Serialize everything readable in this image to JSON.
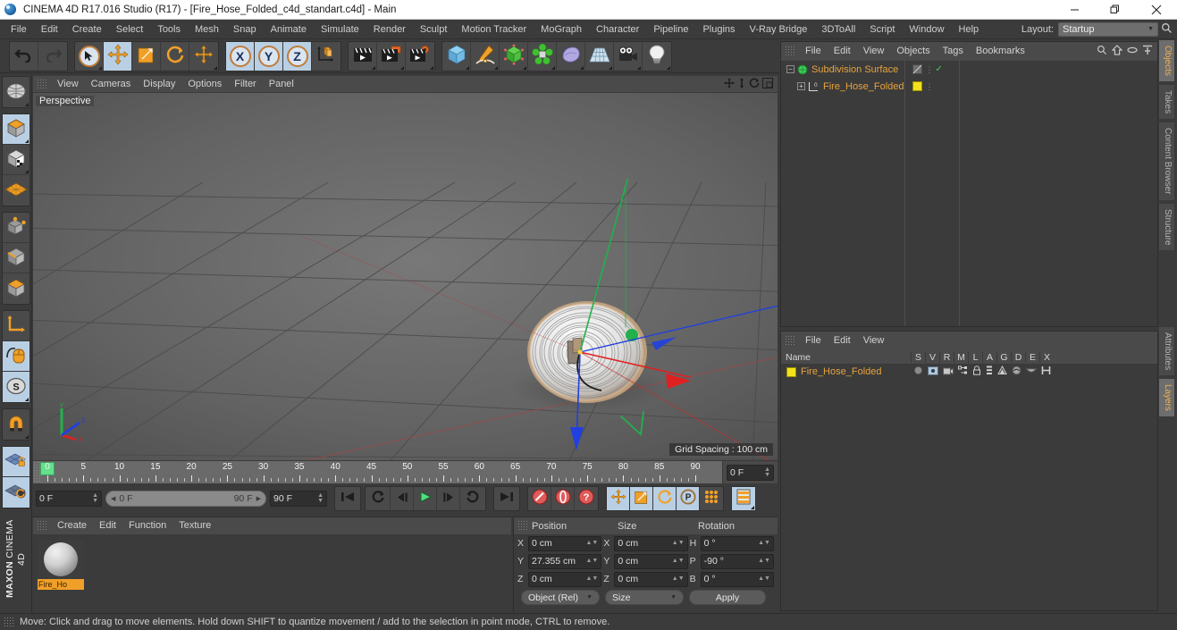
{
  "window": {
    "title": "CINEMA 4D R17.016 Studio (R17) - [Fire_Hose_Folded_c4d_standart.c4d] - Main",
    "app_icon": "c4d-logo-icon",
    "minimize": "minimize-icon",
    "maximize": "restore-icon",
    "close": "close-icon"
  },
  "menubar": {
    "items": [
      "File",
      "Edit",
      "Create",
      "Select",
      "Tools",
      "Mesh",
      "Snap",
      "Animate",
      "Simulate",
      "Render",
      "Sculpt",
      "Motion Tracker",
      "MoGraph",
      "Character",
      "Pipeline",
      "Plugins",
      "V-Ray Bridge",
      "3DToAll",
      "Script",
      "Window",
      "Help"
    ],
    "layout_label": "Layout:",
    "layout_value": "Startup",
    "search_icon": "search-icon"
  },
  "toolbar": {
    "groups": [
      {
        "name": "history",
        "buttons": [
          {
            "name": "undo-button",
            "icon": "undo-arrow-icon",
            "active": false,
            "dim": false
          },
          {
            "name": "redo-button",
            "icon": "redo-arrow-icon",
            "active": false,
            "dim": true
          }
        ]
      },
      {
        "name": "transform",
        "buttons": [
          {
            "name": "live-selection-button",
            "icon": "cursor-circle-icon",
            "active": false,
            "dim": false
          },
          {
            "name": "move-tool-button",
            "icon": "move-cross-icon",
            "active": true,
            "dim": false
          },
          {
            "name": "scale-tool-button",
            "icon": "scale-square-icon",
            "active": false,
            "dim": false
          },
          {
            "name": "rotate-tool-button",
            "icon": "rotate-circle-icon",
            "active": false,
            "dim": false
          },
          {
            "name": "free-move-button",
            "icon": "move-cross-icon",
            "active": false,
            "dim": false
          }
        ]
      },
      {
        "name": "axis-locks",
        "buttons": [
          {
            "name": "x-axis-lock-button",
            "icon": "x-axis-icon",
            "label": "X",
            "active": true,
            "dim": false
          },
          {
            "name": "y-axis-lock-button",
            "icon": "y-axis-icon",
            "label": "Y",
            "active": true,
            "dim": false
          },
          {
            "name": "z-axis-lock-button",
            "icon": "z-axis-icon",
            "label": "Z",
            "active": true,
            "dim": false
          },
          {
            "name": "world-object-coordinates-button",
            "icon": "world-axis-cube-icon",
            "active": false,
            "dim": false
          }
        ]
      },
      {
        "name": "render",
        "buttons": [
          {
            "name": "render-view-button",
            "icon": "clapperboard-icon",
            "active": false,
            "dim": false
          },
          {
            "name": "render-to-picture-viewer-button",
            "icon": "clapperboard-window-icon",
            "active": false,
            "dim": false
          },
          {
            "name": "render-settings-button",
            "icon": "clapperboard-gear-icon",
            "active": false,
            "dim": false
          }
        ]
      },
      {
        "name": "objects",
        "buttons": [
          {
            "name": "add-cube-button",
            "icon": "blue-cube-icon",
            "active": false,
            "dim": false
          },
          {
            "name": "add-spline-button",
            "icon": "pen-spline-icon",
            "active": false,
            "dim": false
          },
          {
            "name": "add-nurbs-button",
            "icon": "green-cube-nurbs-icon",
            "active": false,
            "dim": false
          },
          {
            "name": "add-array-button",
            "icon": "green-cluster-icon",
            "active": false,
            "dim": false
          },
          {
            "name": "add-deformer-button",
            "icon": "purple-blob-deformer-icon",
            "active": false,
            "dim": false
          },
          {
            "name": "add-environment-button",
            "icon": "floor-grid-icon",
            "active": false,
            "dim": false
          },
          {
            "name": "add-camera-button",
            "icon": "camera-icon",
            "active": false,
            "dim": false
          },
          {
            "name": "add-light-button",
            "icon": "lightbulb-icon",
            "active": false,
            "dim": false
          }
        ]
      }
    ]
  },
  "left_toolbar": {
    "groups": [
      {
        "name": "viewport-mode",
        "buttons": [
          {
            "name": "make-editable-button",
            "icon": "wire-globe-icon",
            "active": false
          }
        ]
      },
      {
        "name": "mode-group-1",
        "buttons": [
          {
            "name": "model-mode-button",
            "icon": "model-cube-icon",
            "active": true
          },
          {
            "name": "texture-mode-button",
            "icon": "texture-checker-cube-icon",
            "active": false
          },
          {
            "name": "workplane-mode-button",
            "icon": "orange-grid-plane-icon",
            "active": false
          }
        ]
      },
      {
        "name": "component-group",
        "buttons": [
          {
            "name": "points-mode-button",
            "icon": "point-cube-icon",
            "active": false
          },
          {
            "name": "edges-mode-button",
            "icon": "edge-cube-icon",
            "active": false
          },
          {
            "name": "polygons-mode-button",
            "icon": "polygon-cube-icon",
            "active": false
          }
        ]
      },
      {
        "name": "axis-group",
        "buttons": [
          {
            "name": "enable-axis-modification-button",
            "icon": "axis-l-icon",
            "active": false
          },
          {
            "name": "viewport-solo-button",
            "icon": "mouse-icon",
            "active": true
          },
          {
            "name": "soft-selection-button",
            "icon": "s-circle-icon",
            "active": true
          }
        ]
      },
      {
        "name": "snap-group",
        "buttons": [
          {
            "name": "enable-snap-button",
            "icon": "magnet-icon",
            "active": false
          }
        ]
      },
      {
        "name": "workplane-group",
        "buttons": [
          {
            "name": "lock-workplane-button",
            "icon": "grid-lock-icon",
            "active": true
          },
          {
            "name": "planar-workplane-button",
            "icon": "grid-rotate-icon",
            "active": true
          }
        ]
      }
    ],
    "brand_line1": "MAXON",
    "brand_line2": "CINEMA 4D"
  },
  "viewport": {
    "menu_items": [
      "View",
      "Cameras",
      "Display",
      "Options",
      "Filter",
      "Panel"
    ],
    "nav_icons": [
      "pan-icon",
      "dolly-icon",
      "rotate-icon",
      "maximize-view-icon"
    ],
    "label": "Perspective",
    "grid_spacing": "Grid Spacing : 100 cm",
    "axis_gizmo": "viewport-axis-gizmo",
    "object_name": "Fire_Hose_Folded",
    "gizmo_axes": [
      {
        "axis": "Y",
        "color": "#22b14c"
      },
      {
        "axis": "X",
        "color": "#e02020"
      },
      {
        "axis": "Z",
        "color": "#2040e0"
      }
    ]
  },
  "timeline": {
    "ticks": [
      0,
      5,
      10,
      15,
      20,
      25,
      30,
      35,
      40,
      45,
      50,
      55,
      60,
      65,
      70,
      75,
      80,
      85,
      90
    ],
    "current_frame": "0 F",
    "range_start": "0 F",
    "range_end": "90 F",
    "max_frame": "90 F",
    "end_field": "0 F",
    "controls": [
      {
        "name": "go-to-start-button",
        "icon": "skip-to-start-icon"
      },
      {
        "name": "play-reverse-loop-button",
        "icon": "loop-icon"
      },
      {
        "name": "step-back-button",
        "icon": "step-back-icon"
      },
      {
        "name": "play-button",
        "icon": "play-icon"
      },
      {
        "name": "step-forward-button",
        "icon": "step-forward-icon"
      },
      {
        "name": "play-forward-loop-button",
        "icon": "loop-forward-icon"
      },
      {
        "name": "go-to-end-button",
        "icon": "skip-to-end-icon"
      },
      {
        "name": "record-active-objects-button",
        "icon": "record-keyframe-icon"
      },
      {
        "name": "autokeying-button",
        "icon": "autokey-icon"
      },
      {
        "name": "keyframe-selection-button",
        "icon": "question-key-icon"
      },
      {
        "name": "position-key-button",
        "icon": "move-key-icon"
      },
      {
        "name": "scale-key-button",
        "icon": "scale-key-icon"
      },
      {
        "name": "rotation-key-button",
        "icon": "rotate-key-icon"
      },
      {
        "name": "parameter-key-button",
        "icon": "p-key-icon"
      },
      {
        "name": "point-level-animation-button",
        "icon": "pla-dots-icon"
      },
      {
        "name": "timeline-layout-button",
        "icon": "timeline-panel-icon"
      }
    ]
  },
  "material_manager": {
    "menu_items": [
      "Create",
      "Edit",
      "Function",
      "Texture"
    ],
    "materials": [
      {
        "name": "Fire_Ho",
        "full_name": "Fire_Hose_Folded",
        "selected": true
      }
    ]
  },
  "coordinates": {
    "col_position": "Position",
    "col_size": "Size",
    "col_rotation": "Rotation",
    "rows": [
      {
        "pos_axis": "X",
        "pos_value": "0 cm",
        "size_axis": "X",
        "size_value": "0 cm",
        "rot_axis": "H",
        "rot_value": "0 °"
      },
      {
        "pos_axis": "Y",
        "pos_value": "27.355 cm",
        "size_axis": "Y",
        "size_value": "0 cm",
        "rot_axis": "P",
        "rot_value": "-90 °"
      },
      {
        "pos_axis": "Z",
        "pos_value": "0 cm",
        "size_axis": "Z",
        "size_value": "0 cm",
        "rot_axis": "B",
        "rot_value": "0 °"
      }
    ],
    "mode_dropdown": "Object (Rel)",
    "size_dropdown": "Size",
    "apply_button": "Apply"
  },
  "object_manager": {
    "menu_items": [
      "File",
      "Edit",
      "View",
      "Objects",
      "Tags",
      "Bookmarks"
    ],
    "header_icons": [
      "search-icon",
      "home-icon",
      "link-icon",
      "fit-icon"
    ],
    "items": [
      {
        "name": "Subdivision Surface",
        "icon": "green-sphere-icon",
        "selected": true,
        "indent": 0,
        "tag_icon": "hidden-render-tag-icon",
        "check": "✓"
      },
      {
        "name": "Fire_Hose_Folded",
        "icon": "polygon-object-icon",
        "selected": true,
        "indent": 1,
        "tag_icon": "yellow-material-tag-icon",
        "check": ""
      }
    ]
  },
  "layer_manager": {
    "menu_items": [
      "File",
      "Edit",
      "View"
    ],
    "columns": [
      "Name",
      "S",
      "V",
      "R",
      "M",
      "L",
      "A",
      "G",
      "D",
      "E",
      "X"
    ],
    "rows": [
      {
        "name": "Fire_Hose_Folded",
        "color": "#f2e21a",
        "icons": [
          "solo-dot-icon",
          "view-icon",
          "render-camera-icon",
          "manager-icon",
          "lock-icon",
          "animation-icon",
          "generator-icon",
          "deformer-icon",
          "expression-icon",
          "xref-icon"
        ]
      }
    ]
  },
  "vertical_tabs": {
    "top": [
      {
        "label": "Objects",
        "active": true
      },
      {
        "label": "Takes",
        "active": false
      },
      {
        "label": "Content Browser",
        "active": false
      },
      {
        "label": "Structure",
        "active": false
      }
    ],
    "bottom": [
      {
        "label": "Attributes",
        "active": false
      },
      {
        "label": "Layers",
        "active": true
      }
    ]
  },
  "statusbar": {
    "message": "Move: Click and drag to move elements. Hold down SHIFT to quantize movement / add to the selection in point mode, CTRL to remove."
  },
  "colors": {
    "panel_bg": "#3b3b3b",
    "header_bg": "#4a4a4a",
    "viewport_bg": "#5e5e5e",
    "accent_orange": "#e8a33d",
    "active_blue": "#b9cfe4",
    "material_label": "#f0a028",
    "layer_yellow": "#f2e21a"
  }
}
